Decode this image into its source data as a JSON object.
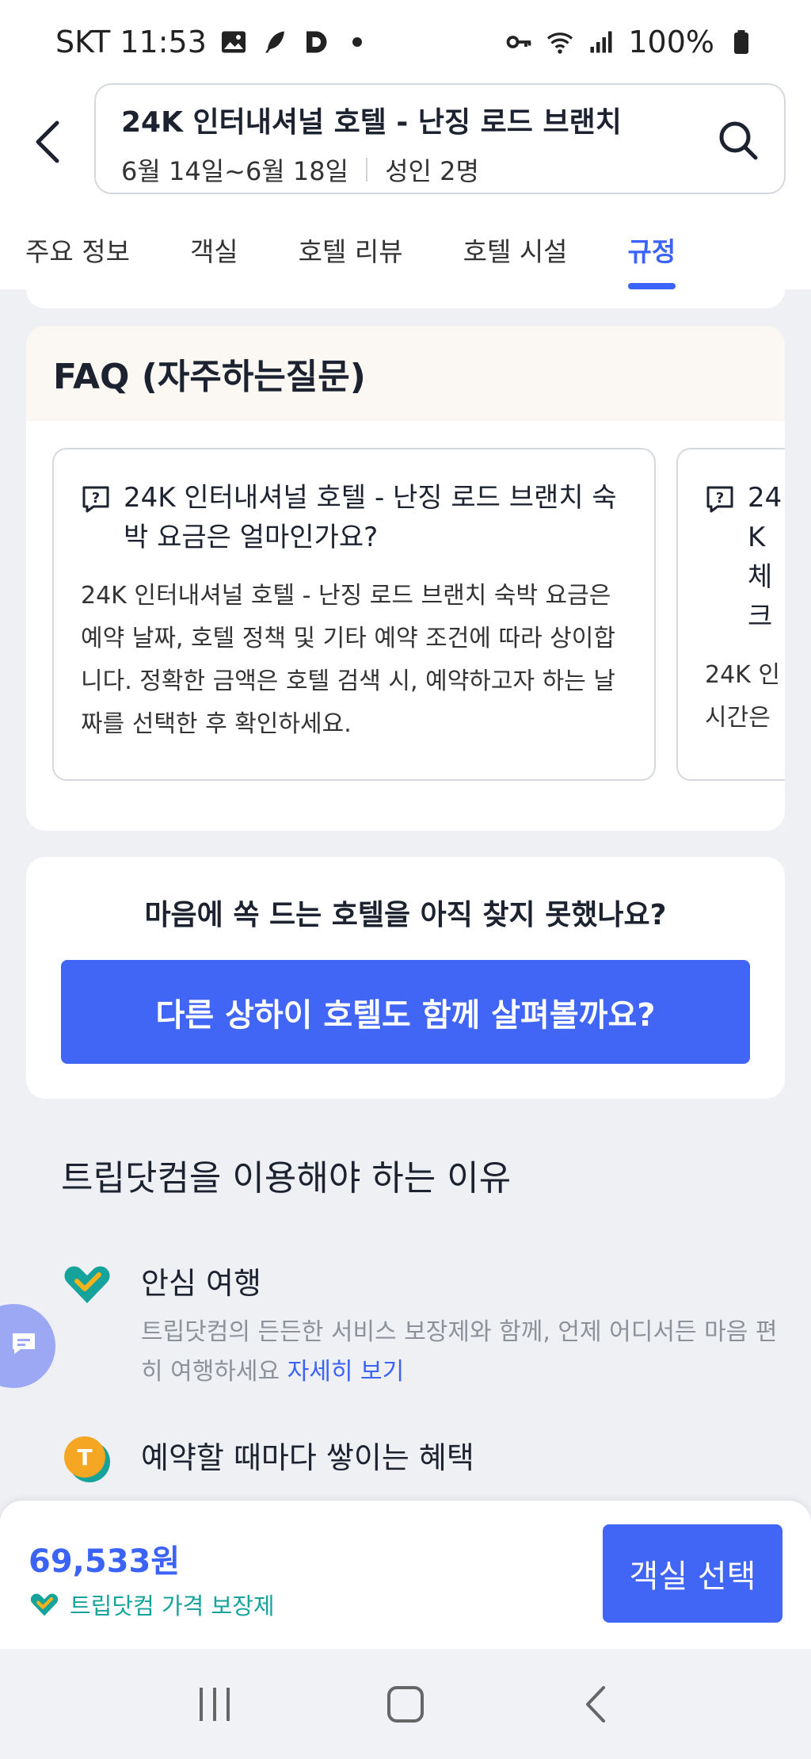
{
  "status_bar": {
    "carrier_time": "SKT 11:53",
    "battery": "100%"
  },
  "header": {
    "hotel_name": "24K 인터내셔널 호텔 - 난징 로드 브랜치",
    "dates": "6월 14일~6월 18일",
    "guests": "성인 2명"
  },
  "tabs": [
    {
      "label": "주요 정보",
      "active": false
    },
    {
      "label": "객실",
      "active": false
    },
    {
      "label": "호텔 리뷰",
      "active": false
    },
    {
      "label": "호텔 시설",
      "active": false
    },
    {
      "label": "규정",
      "active": true
    }
  ],
  "faq": {
    "title": "FAQ (자주하는질문)",
    "items": [
      {
        "question": "24K 인터내셔널 호텔 - 난징 로드 브랜치 숙박 요금은 얼마인가요?",
        "answer": "24K 인터내셔널 호텔 - 난징 로드 브랜치 숙박 요금은 예약 날짜, 호텔 정책 및 기타 예약 조건에 따라 상이합니다. 정확한 금액은 호텔 검색 시, 예약하고자 하는 날짜를 선택한 후 확인하세요."
      },
      {
        "question": "24K 체크",
        "answer": "24K 인 시간은"
      }
    ]
  },
  "find_hotel": {
    "title": "마음에 쏙 드는 호텔을 아직 찾지 못했나요?",
    "button": "다른 상하이 호텔도 함께 살펴볼까요?"
  },
  "why": {
    "title": "트립닷컴을 이용해야 하는 이유",
    "items": [
      {
        "heading": "안심 여행",
        "desc": "트립닷컴의 든든한 서비스 보장제와 함께, 언제 어디서든 마음 편히 여행하세요",
        "link": "자세히 보기"
      },
      {
        "heading": "예약할 때마다 쌓이는 혜택"
      }
    ]
  },
  "bottom_bar": {
    "price": "69,533원",
    "guarantee": "트립닷컴 가격 보장제",
    "select_button": "객실 선택"
  },
  "colors": {
    "accent": "#3b63f7",
    "button": "#4166f5",
    "teal": "#16a39b"
  }
}
